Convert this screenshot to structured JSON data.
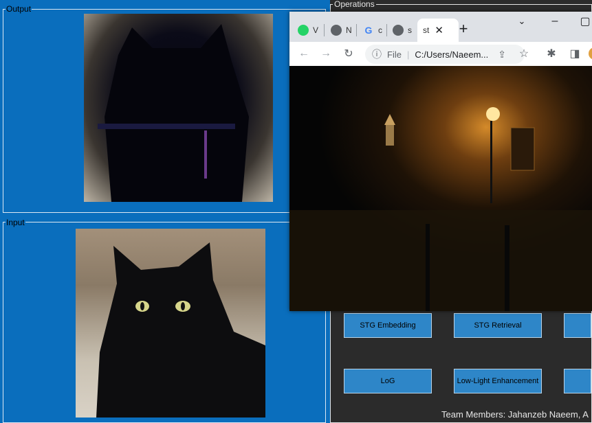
{
  "output_group": {
    "label": "Output"
  },
  "input_group": {
    "label": "Input"
  },
  "operations": {
    "label": "Operations",
    "buttons": [
      "STG Embedding",
      "STG Retrieval",
      "LoG",
      "Low-Light Enhancement"
    ]
  },
  "footer": {
    "team": "Team Members: Jahanzeb Naeem, A"
  },
  "browser": {
    "tabs": [
      {
        "icon": "whatsapp-icon",
        "label": "V"
      },
      {
        "icon": "chrome-icon",
        "label": "N"
      },
      {
        "icon": "google-icon",
        "label": "c"
      },
      {
        "icon": "globe-icon",
        "label": "s"
      },
      {
        "icon": "",
        "label": "st"
      }
    ],
    "address_prefix": "File",
    "address": "C:/Users/Naeem..."
  }
}
